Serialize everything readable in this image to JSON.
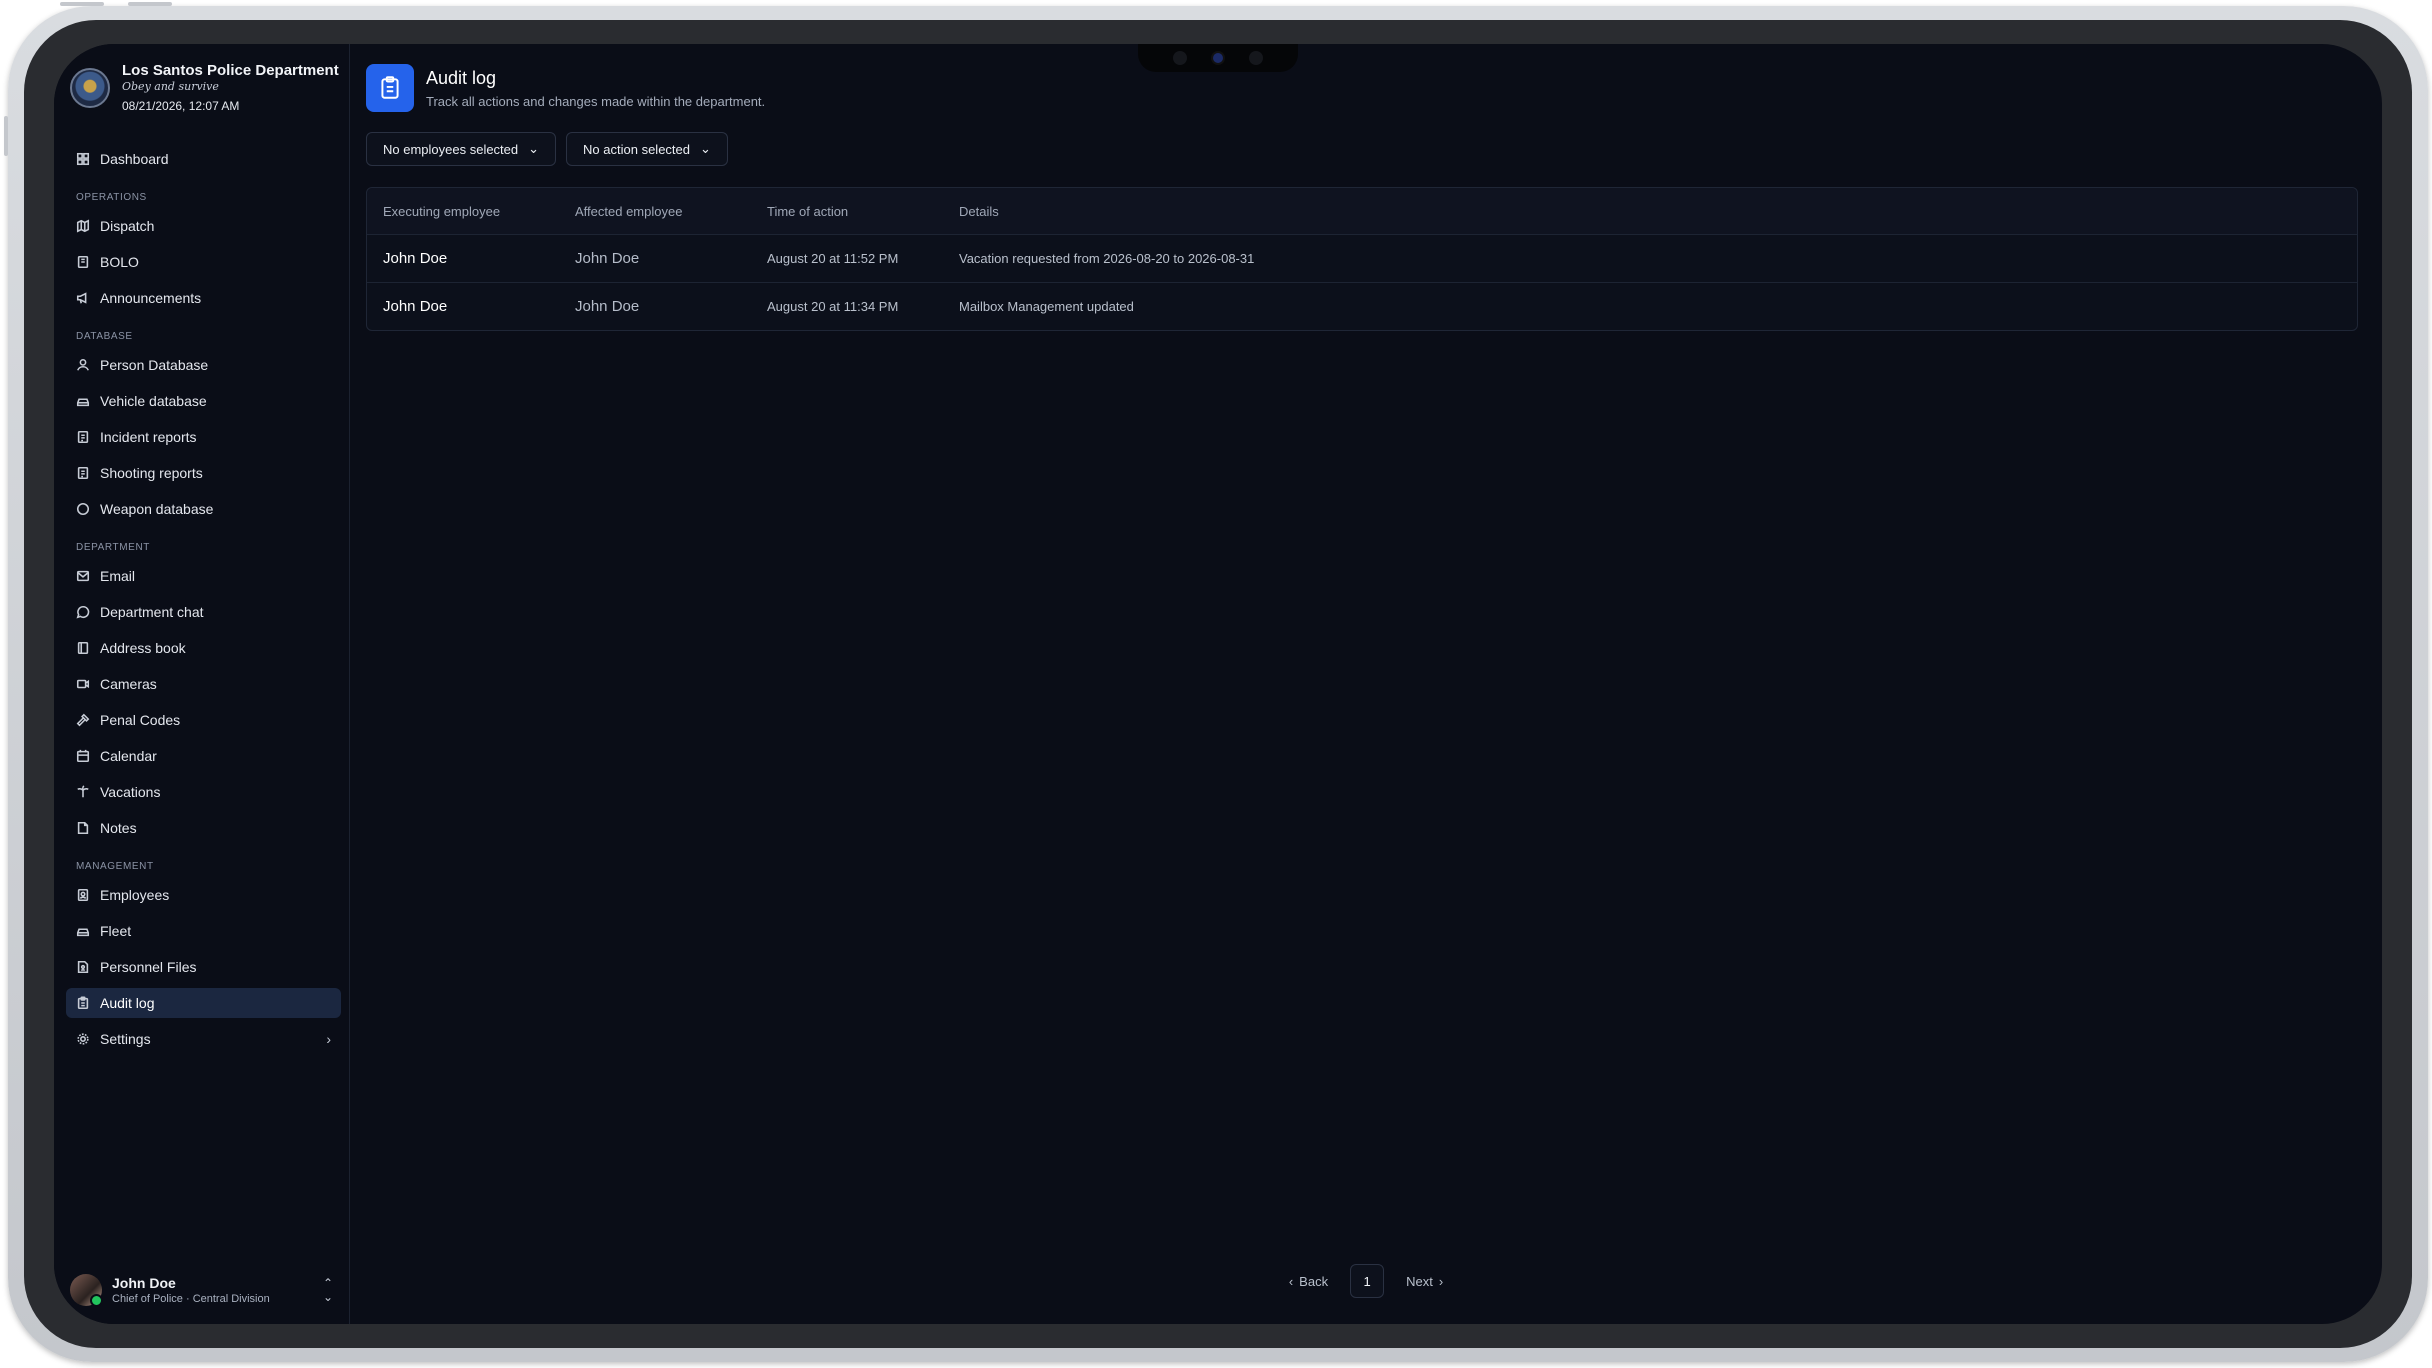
{
  "brand": {
    "name": "Los Santos Police Department",
    "motto": "Obey and survive",
    "datetime": "08/21/2026, 12:07 AM"
  },
  "sidebar": {
    "dashboard": "Dashboard",
    "sections": {
      "operations": "OPERATIONS",
      "database": "DATABASE",
      "department": "DEPARTMENT",
      "management": "MANAGEMENT"
    },
    "operations": [
      "Dispatch",
      "BOLO",
      "Announcements"
    ],
    "database": [
      "Person Database",
      "Vehicle database",
      "Incident reports",
      "Shooting reports",
      "Weapon database"
    ],
    "department": [
      "Email",
      "Department chat",
      "Address book",
      "Cameras",
      "Penal Codes",
      "Calendar",
      "Vacations",
      "Notes"
    ],
    "management": [
      "Employees",
      "Fleet",
      "Personnel Files",
      "Audit log"
    ],
    "settings": "Settings"
  },
  "user": {
    "name": "John Doe",
    "role": "Chief of Police · Central Division"
  },
  "page": {
    "title": "Audit log",
    "subtitle": "Track all actions and changes made within the department."
  },
  "filters": {
    "employees": "No employees selected",
    "action": "No action selected"
  },
  "table": {
    "headers": [
      "Executing employee",
      "Affected employee",
      "Time of action",
      "Details"
    ],
    "rows": [
      {
        "executing": "John Doe",
        "affected": "John Doe",
        "time": "August 20 at 11:52 PM",
        "details": "Vacation requested from 2026-08-20 to 2026-08-31"
      },
      {
        "executing": "John Doe",
        "affected": "John Doe",
        "time": "August 20 at 11:34 PM",
        "details": "Mailbox Management updated"
      }
    ]
  },
  "pagination": {
    "back": "Back",
    "page": "1",
    "next": "Next"
  },
  "colors": {
    "accent": "#2563eb",
    "background": "#0a0d17",
    "active_nav": "#1b2740",
    "status_online": "#22c55e"
  }
}
